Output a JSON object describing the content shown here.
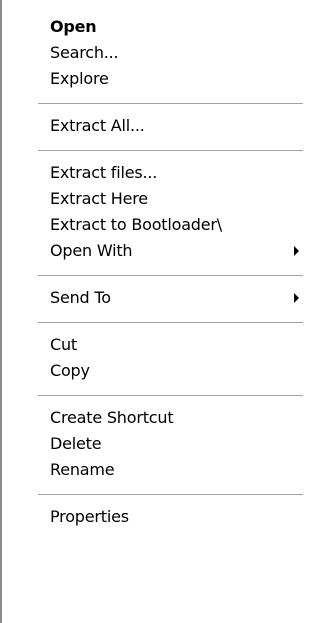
{
  "context_menu": {
    "open": "Open",
    "search": "Search...",
    "explore": "Explore",
    "extract_all": "Extract All...",
    "extract_files": "Extract files...",
    "extract_here": "Extract Here",
    "extract_to": "Extract to Bootloader\\",
    "open_with": "Open With",
    "send_to": "Send To",
    "cut": "Cut",
    "copy": "Copy",
    "create_shortcut": "Create Shortcut",
    "delete": "Delete",
    "rename": "Rename",
    "properties": "Properties"
  },
  "icons": {
    "submenu_arrow": "submenu-arrow-icon"
  },
  "colors": {
    "background": "#ffffff",
    "separator": "#a0a0a0",
    "border": "#8c8c8c",
    "text": "#000000"
  }
}
